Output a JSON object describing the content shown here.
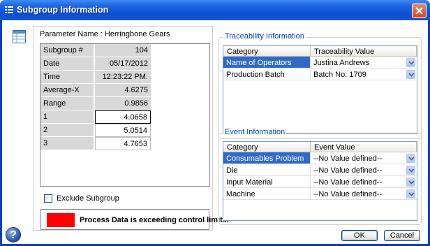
{
  "window": {
    "title": "Subgroup Information",
    "title_icon": "list-icon",
    "close_icon": "close-icon"
  },
  "parameter": {
    "label": "Parameter Name : Herringbone Gears"
  },
  "subgroup_table": {
    "rows": [
      {
        "label": "Subgroup #",
        "value": "104"
      },
      {
        "label": "Date",
        "value": "05/17/2012"
      },
      {
        "label": "Time",
        "value": "12:23:22 PM."
      },
      {
        "label": "Average-X",
        "value": "4.6275"
      },
      {
        "label": "Range",
        "value": "0.9856"
      },
      {
        "label": "1",
        "value": "4.0658"
      },
      {
        "label": "2",
        "value": "5.0514"
      },
      {
        "label": "3",
        "value": "4.7653"
      }
    ]
  },
  "exclude": {
    "label": "Exclude Subgroup",
    "checked": false
  },
  "alert": {
    "text": "Process Data is exceeding control limits.",
    "color": "#ff0000"
  },
  "traceability": {
    "group_label": "Traceability Information",
    "headers": [
      "Category",
      "Traceability Value"
    ],
    "rows": [
      {
        "category": "Name of Operators",
        "value": "Justina Andrews"
      },
      {
        "category": "Production Batch",
        "value": "Batch No: 1709"
      }
    ]
  },
  "events": {
    "group_label": "Event Information",
    "headers": [
      "Category",
      "Event Value"
    ],
    "rows": [
      {
        "category": "Consumables Problem",
        "value": "--No Value defined--"
      },
      {
        "category": "Die",
        "value": "--No Value defined--"
      },
      {
        "category": "Input Material",
        "value": "--No Value defined--"
      },
      {
        "category": "Machine",
        "value": "--No Value defined--"
      }
    ]
  },
  "buttons": {
    "ok": "OK",
    "cancel": "Cancel",
    "help": "?"
  },
  "colors": {
    "titlebar": "#0a4fd8",
    "selection": "#316ac5",
    "group_label": "#0046d5"
  }
}
